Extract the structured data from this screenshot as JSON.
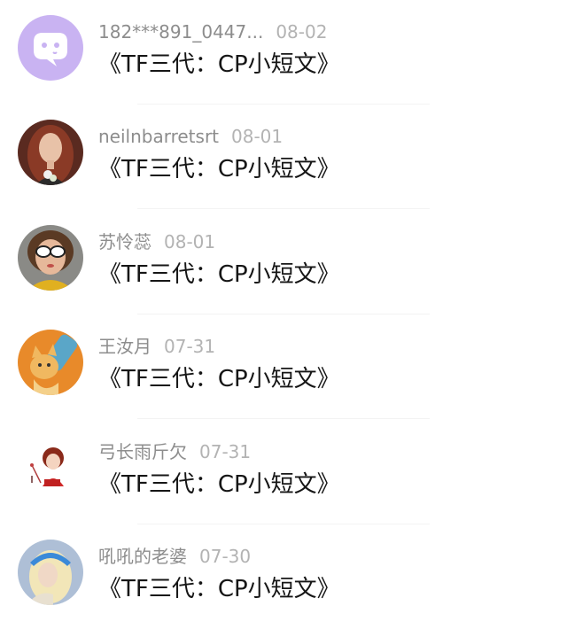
{
  "comments": [
    {
      "user": "182***891_0447...",
      "date": "08-02",
      "title": "《TF三代：CP小短文》",
      "avatar": "default-chat-avatar"
    },
    {
      "user": "neilnbarretsrt",
      "date": "08-01",
      "title": "《TF三代：CP小短文》",
      "avatar": "red-hair-woman-avatar"
    },
    {
      "user": "苏怜蕊",
      "date": "08-01",
      "title": "《TF三代：CP小短文》",
      "avatar": "sunglasses-woman-avatar"
    },
    {
      "user": "王汝月",
      "date": "07-31",
      "title": "《TF三代：CP小短文》",
      "avatar": "cartoon-cat-avatar"
    },
    {
      "user": "弓长雨斤欠",
      "date": "07-31",
      "title": "《TF三代：CP小短文》",
      "avatar": "cartoon-girl-avatar"
    },
    {
      "user": "吼吼的老婆",
      "date": "07-30",
      "title": "《TF三代：CP小短文》",
      "avatar": "blonde-blue-headband-avatar"
    }
  ],
  "colors": {
    "default_avatar_bg": "#c9b3f2",
    "username": "#8d8d8d",
    "date": "#b3b3b3",
    "title": "#161616"
  }
}
